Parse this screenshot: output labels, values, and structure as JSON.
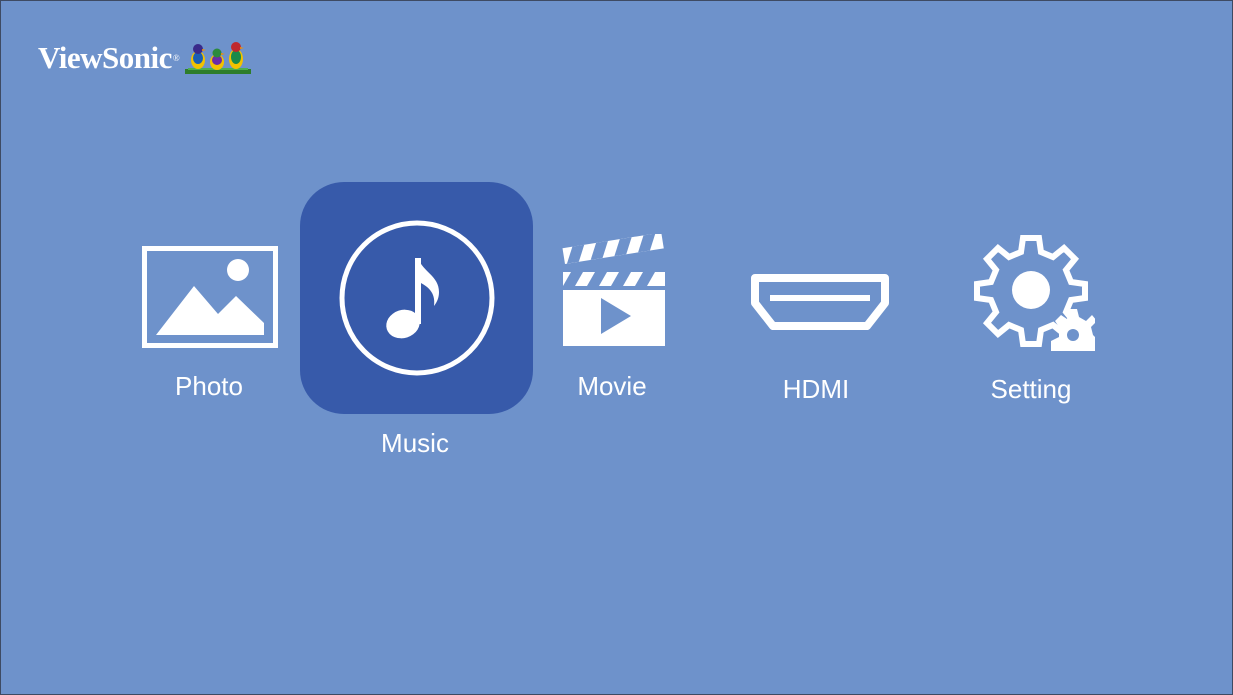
{
  "brand": {
    "name": "ViewSonic",
    "registered_mark": "®"
  },
  "colors": {
    "background": "#6e92cb",
    "selected_tile": "#375aaa",
    "icon": "#ffffff",
    "text": "#ffffff"
  },
  "menu": {
    "selected": "Music",
    "items": [
      {
        "id": "photo",
        "label": "Photo",
        "icon": "picture-icon"
      },
      {
        "id": "music",
        "label": "Music",
        "icon": "music-note-icon"
      },
      {
        "id": "movie",
        "label": "Movie",
        "icon": "clapperboard-icon"
      },
      {
        "id": "hdmi",
        "label": "HDMI",
        "icon": "hdmi-port-icon"
      },
      {
        "id": "setting",
        "label": "Setting",
        "icon": "gear-icon"
      }
    ]
  }
}
